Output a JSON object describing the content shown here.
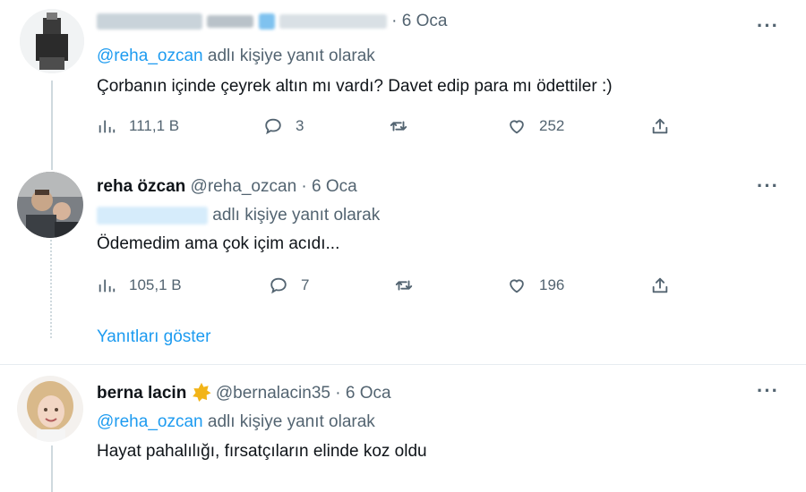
{
  "tweets": [
    {
      "name": "",
      "handle": "",
      "time": "6 Oca",
      "reply_prefix": "@reha_ozcan",
      "reply_suffix": "adlı kişiye yanıt olarak",
      "text": "Çorbanın içinde çeyrek altın mı vardı? Davet edip para mı ödettiler :)",
      "views": "111,1 B",
      "replies": "3",
      "retweets": "",
      "likes": "252"
    },
    {
      "name": "reha özcan",
      "handle": "@reha_ozcan",
      "time": "6 Oca",
      "reply_prefix": "",
      "reply_suffix": "adlı kişiye yanıt olarak",
      "text": "Ödemedim ama çok içim acıdı...",
      "views": "105,1 B",
      "replies": "7",
      "retweets": "",
      "likes": "196"
    },
    {
      "name": "berna lacin",
      "handle": "@bernalacin35",
      "time": "6 Oca",
      "reply_prefix": "@reha_ozcan",
      "reply_suffix": "adlı kişiye yanıt olarak",
      "text": "Hayat pahalılığı, fırsatçıların elinde koz oldu"
    }
  ],
  "show_replies": "Yanıtları göster",
  "separator_dot": "·",
  "more_label": "···",
  "icons": {
    "views": "bar-chart-icon",
    "reply": "speech-bubble-icon",
    "retweet": "retweet-icon",
    "like": "heart-icon",
    "share": "share-icon",
    "verified": "gold-badge-icon"
  },
  "colors": {
    "accent": "#1d9bf0",
    "muted": "#536471",
    "badge": "#f2b418"
  }
}
